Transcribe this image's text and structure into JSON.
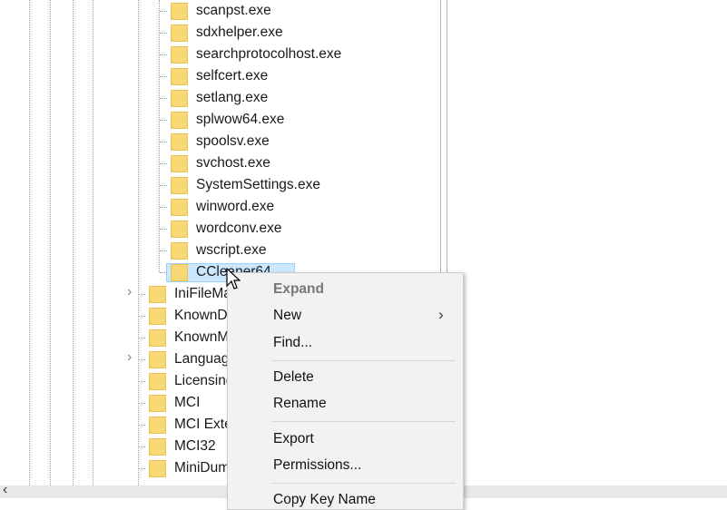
{
  "tree": {
    "subkeys": [
      "scanpst.exe",
      "sdxhelper.exe",
      "searchprotocolhost.exe",
      "selfcert.exe",
      "setlang.exe",
      "splwow64.exe",
      "spoolsv.exe",
      "svchost.exe",
      "SystemSettings.exe",
      "winword.exe",
      "wordconv.exe",
      "wscript.exe"
    ],
    "selected": "CCleaner64",
    "siblings": [
      {
        "label": "IniFileMapping",
        "expandable": true
      },
      {
        "label": "KnownDLLs",
        "expandable": false
      },
      {
        "label": "KnownManagedDebuggingDlls",
        "expandable": false
      },
      {
        "label": "LanguagePack",
        "expandable": true
      },
      {
        "label": "LicensingDiag",
        "expandable": false
      },
      {
        "label": "MCI",
        "expandable": false
      },
      {
        "label": "MCI Extensions",
        "expandable": false
      },
      {
        "label": "MCI32",
        "expandable": false
      },
      {
        "label": "MiniDumpAuxiliaryDlls",
        "expandable": false
      }
    ]
  },
  "context_menu": {
    "expand": "Expand",
    "new": "New",
    "new_arrow": "›",
    "find": "Find...",
    "delete": "Delete",
    "rename": "Rename",
    "export": "Export",
    "permissions": "Permissions...",
    "copy_key_name": "Copy Key Name"
  },
  "scrollbar": {
    "left_arrow": "‹"
  }
}
